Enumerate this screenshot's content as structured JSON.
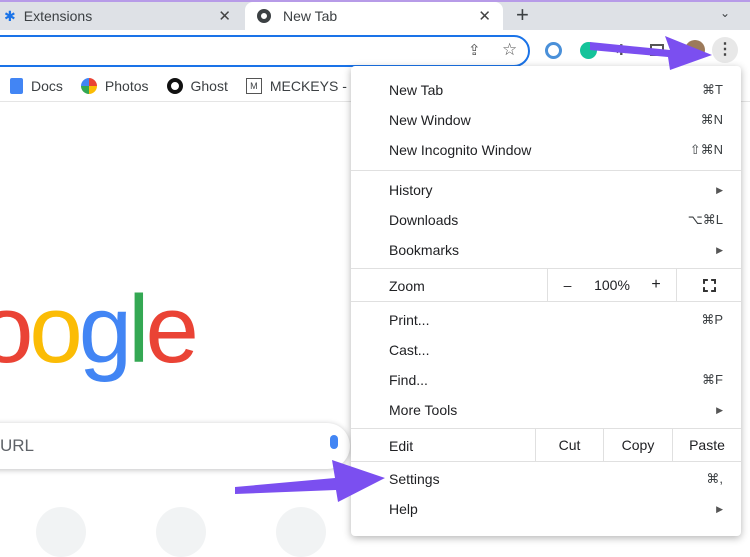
{
  "tabs": [
    {
      "label": "Extensions",
      "icon": "puzzle-icon"
    },
    {
      "label": "New Tab",
      "icon": "chrome-icon"
    }
  ],
  "bookmarks": [
    {
      "label": "Docs"
    },
    {
      "label": "Photos"
    },
    {
      "label": "Ghost"
    },
    {
      "label": "MECKEYS -"
    }
  ],
  "logo_text": "oogle",
  "search_placeholder": "URL",
  "menu": {
    "items1": [
      {
        "label": "New Tab",
        "shortcut": "⌘T"
      },
      {
        "label": "New Window",
        "shortcut": "⌘N"
      },
      {
        "label": "New Incognito Window",
        "shortcut": "⇧⌘N"
      }
    ],
    "items2": [
      {
        "label": "History",
        "arrow": "▶"
      },
      {
        "label": "Downloads",
        "shortcut": "⌥⌘L"
      },
      {
        "label": "Bookmarks",
        "arrow": "▶"
      }
    ],
    "zoom": {
      "label": "Zoom",
      "minus": "–",
      "value": "100%",
      "plus": "+"
    },
    "items3": [
      {
        "label": "Print...",
        "shortcut": "⌘P"
      },
      {
        "label": "Cast..."
      },
      {
        "label": "Find...",
        "shortcut": "⌘F"
      },
      {
        "label": "More Tools",
        "arrow": "▶"
      }
    ],
    "edit": {
      "label": "Edit",
      "cut": "Cut",
      "copy": "Copy",
      "paste": "Paste"
    },
    "items4": [
      {
        "label": "Settings",
        "shortcut": "⌘,"
      },
      {
        "label": "Help",
        "arrow": "▶"
      }
    ]
  },
  "colors": {
    "accent": "#1a73e8",
    "arrow": "#7b4ff0"
  }
}
